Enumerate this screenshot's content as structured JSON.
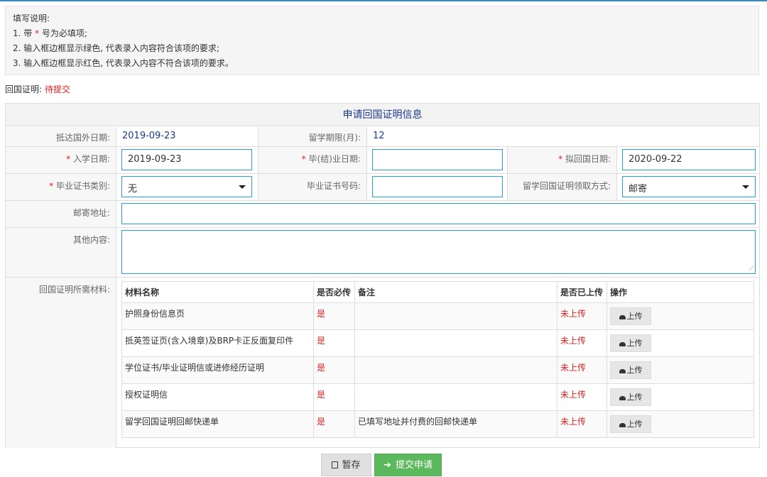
{
  "notes": {
    "title": "填写说明:",
    "line1_pre": "1. 带",
    "line1_star": "*",
    "line1_post": "号为必填项;",
    "line2": "2. 输入框边框显示绿色, 代表录入内容符合该项的要求;",
    "line3": "3. 输入框边框显示红色, 代表录入内容不符合该项的要求。"
  },
  "status": {
    "label": "回国证明:",
    "value": "待提交"
  },
  "form": {
    "title": "申请回国证明信息",
    "arrival_date_label": "抵达国外日期:",
    "arrival_date_value": "2019-09-23",
    "study_period_label": "留学期限(月):",
    "study_period_value": "12",
    "enroll_date_label": "入学日期:",
    "enroll_date_value": "2019-09-23",
    "graduate_date_label": "毕(结)业日期:",
    "graduate_date_value": "",
    "return_date_label": "拟回国日期:",
    "return_date_value": "2020-09-22",
    "cert_type_label": "毕业证书类别:",
    "cert_type_value": "无",
    "cert_no_label": "毕业证书号码:",
    "cert_no_value": "",
    "pickup_label": "留学回国证明领取方式:",
    "pickup_value": "邮寄",
    "mail_address_label": "邮寄地址:",
    "mail_address_value": "",
    "other_label": "其他内容:",
    "other_value": "",
    "materials_label": "回国证明所需材料:"
  },
  "materials": {
    "headers": {
      "name": "材料名称",
      "required": "是否必传",
      "note": "备注",
      "uploaded": "是否已上传",
      "action": "操作"
    },
    "upload_label": "上传",
    "rows": [
      {
        "name": "护照身份信息页",
        "required": "是",
        "note": "",
        "uploaded": "未上传"
      },
      {
        "name": "抵英签证页(含入境章)及BRP卡正反面复印件",
        "required": "是",
        "note": "",
        "uploaded": "未上传"
      },
      {
        "name": "学位证书/毕业证明信或进修经历证明",
        "required": "是",
        "note": "",
        "uploaded": "未上传"
      },
      {
        "name": "授权证明信",
        "required": "是",
        "note": "",
        "uploaded": "未上传"
      },
      {
        "name": "留学回国证明回邮快递单",
        "required": "是",
        "note": "已填写地址并付费的回邮快递单",
        "uploaded": "未上传"
      }
    ]
  },
  "buttons": {
    "save": "暂存",
    "submit": "提交申请"
  },
  "colors": {
    "accent": "#2a9fd6",
    "required": "#e02020",
    "submit": "#5cb85c",
    "title": "#1a3a8f"
  }
}
